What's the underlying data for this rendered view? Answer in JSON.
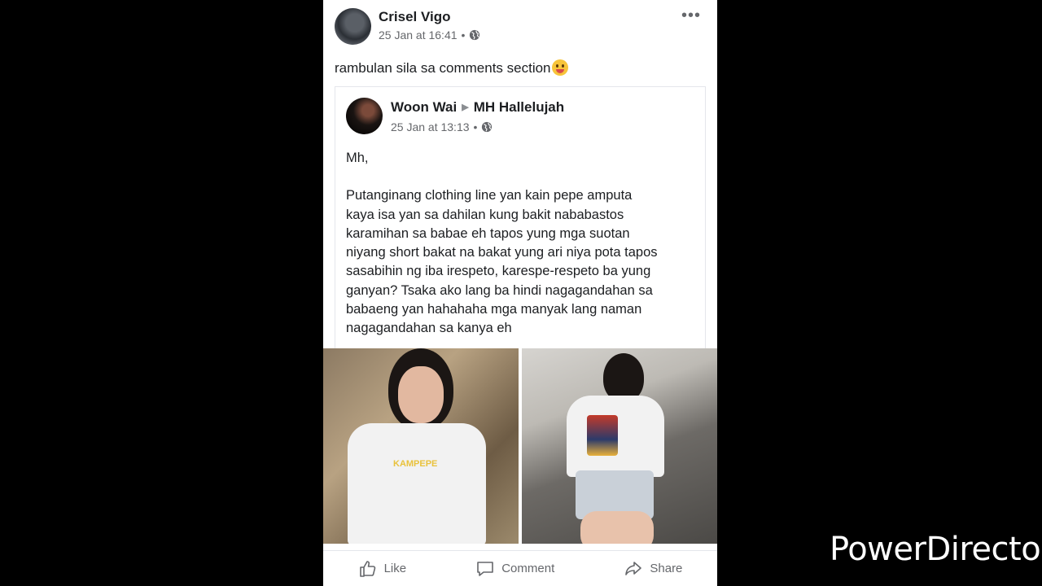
{
  "post": {
    "author": "Crisel Vigo",
    "timestamp": "25 Jan at 16:41",
    "separator": "•",
    "privacy_icon": "globe-icon",
    "more_icon": "more-horizontal-icon",
    "caption": "rambulan sila sa comments section",
    "caption_emoji": "tongue-out-emoji"
  },
  "shared_post": {
    "author": "Woon Wai",
    "target": "MH Hallelujah",
    "arrow_icon": "triangle-right-icon",
    "timestamp": "25 Jan at 13:13",
    "separator": "•",
    "greeting": "Mh,",
    "lines": [
      "Putanginang clothing line yan kain pepe amputa",
      "kaya isa yan sa dahilan kung bakit nababastos",
      "karamihan sa babae eh tapos yung mga suotan",
      "niyang short bakat na bakat yung ari niya pota tapos",
      "sasabihin ng iba irespeto, karespe-respeto ba yung",
      "ganyan? Tsaka ako lang ba hindi nagagandahan sa",
      "babaeng yan hahahaha mga manyak lang naman",
      "nagagandahan sa kanya eh"
    ],
    "shirt_print_text": "KAMPEPE"
  },
  "actions": {
    "like": "Like",
    "comment": "Comment",
    "share": "Share"
  },
  "watermark": "PowerDirector"
}
